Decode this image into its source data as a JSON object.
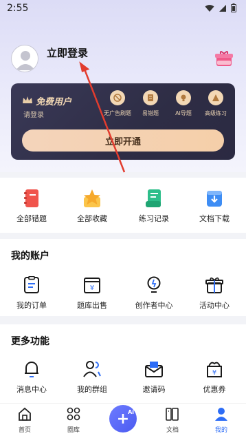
{
  "status": {
    "time": "2:55"
  },
  "header": {
    "login_label": "立即登录"
  },
  "vip": {
    "title": "免费用户",
    "subtitle": "请登录",
    "perks": [
      "无广告刷题",
      "易错题",
      "AI导题",
      "高级练习"
    ],
    "open_button": "立即开通",
    "colors": {
      "card": "#2f2e47",
      "gold": "#f1d7b3",
      "button": "#f4d4bb"
    }
  },
  "quick": {
    "items": [
      "全部错题",
      "全部收藏",
      "练习记录",
      "文档下载"
    ]
  },
  "account": {
    "title": "我的账户",
    "items": [
      "我的订单",
      "题库出售",
      "创作者中心",
      "活动中心"
    ]
  },
  "more": {
    "title": "更多功能",
    "items": [
      "消息中心",
      "我的群组",
      "邀请码",
      "优惠券"
    ]
  },
  "tabbar": {
    "items": [
      "首页",
      "圈库",
      "文档",
      "我的"
    ],
    "fab_label": "Ai",
    "active_color": "#2d6df6"
  }
}
